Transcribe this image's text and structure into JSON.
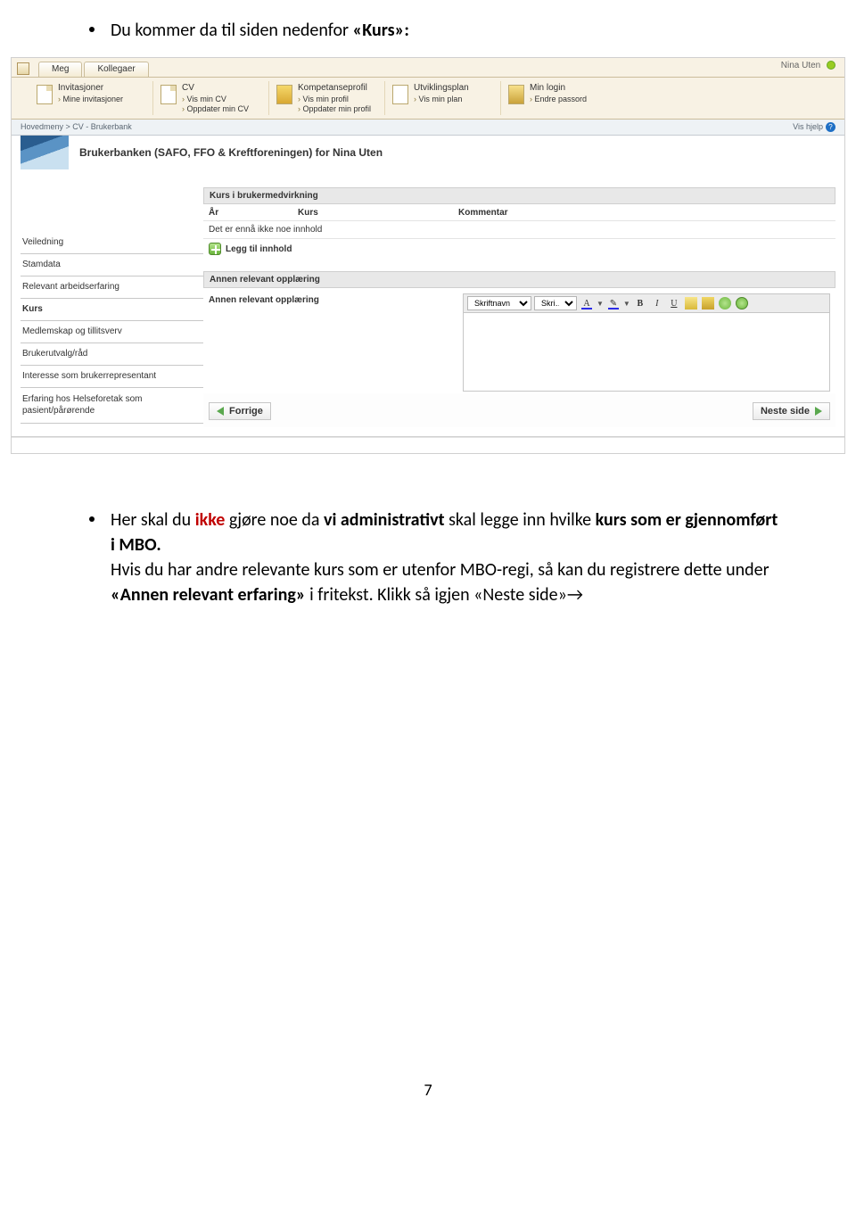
{
  "doc": {
    "bullet1_prefix": "Du kommer da til siden nedenfor ",
    "bullet1_bold": "«Kurs»:",
    "bullet2_p1": "Her skal du ",
    "bullet2_red": "ikke",
    "bullet2_p2": " gjøre noe da ",
    "bullet2_b1": "vi administrativt",
    "bullet2_p3": " skal legge inn hvilke ",
    "bullet2_b2": "kurs som er gjennomført i MBO.",
    "bullet2_line2a": "Hvis du har andre relevante kurs som er utenfor MBO-regi, så kan du registrere dette under ",
    "bullet2_line2b": "«Annen relevant erfaring»",
    "bullet2_line2c": " i fritekst.  Klikk  så igjen «Neste side»→",
    "page_num": "7"
  },
  "app": {
    "tabs": [
      "Meg",
      "Kollegaer"
    ],
    "user": "Nina Uten",
    "nav": [
      {
        "title": "Invitasjoner",
        "links": [
          "Mine invitasjoner"
        ]
      },
      {
        "title": "CV",
        "links": [
          "Vis min CV",
          "Oppdater min CV"
        ]
      },
      {
        "title": "Kompetanseprofil",
        "links": [
          "Vis min profil",
          "Oppdater min profil"
        ]
      },
      {
        "title": "Utviklingsplan",
        "links": [
          "Vis min plan"
        ]
      },
      {
        "title": "Min login",
        "links": [
          "Endre passord"
        ]
      }
    ],
    "breadcrumb": "Hovedmeny  >  CV - Brukerbank",
    "help": "Vis hjelp",
    "banner": "Brukerbanken (SAFO, FFO & Kreftforeningen) for Nina Uten",
    "side": [
      "Veiledning",
      "Stamdata",
      "Relevant arbeidserfaring",
      "Kurs",
      "Medlemskap og tillitsverv",
      "Brukerutvalg/råd",
      "Interesse som brukerrepresentant",
      "Erfaring hos Helseforetak som pasient/pårørende"
    ],
    "side_active_index": 3,
    "section1": "Kurs i brukermedvirkning",
    "cols": {
      "c1": "År",
      "c2": "Kurs",
      "c3": "Kommentar"
    },
    "empty": "Det er ennå ikke noe innhold",
    "add": "Legg til innhold",
    "section2": "Annen relevant opplæring",
    "field_label": "Annen relevant opplæring",
    "toolbar": {
      "font": "Skriftnavn",
      "size": "Skri…"
    },
    "prev": "Forrige",
    "next": "Neste side"
  }
}
